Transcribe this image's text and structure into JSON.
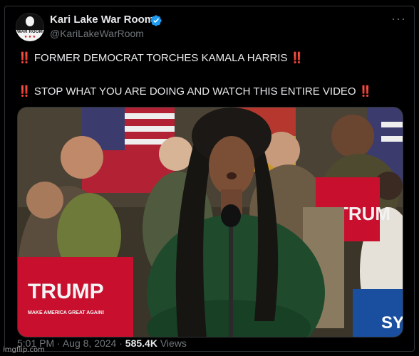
{
  "tweet": {
    "author_name": "Kari Lake War Room",
    "handle": "@KariLakeWarRoom",
    "avatar": {
      "text": "WAR ROOM",
      "stars": "★ ★ ★"
    },
    "more_icon": "more-dots-icon",
    "verified_icon": "verified-badge-icon",
    "text_line_1": "FORMER DEMOCRAT TORCHES KAMALA HARRIS",
    "text_line_2": "STOP WHAT YOU ARE DOING AND WATCH THIS ENTIRE VIDEO",
    "emoji": "‼️",
    "media": {
      "sign_left": {
        "title": "TRUMP",
        "subtitle": "MAKE AMERICA GREAT AGAIN!"
      },
      "sign_right_partial": "TRUM",
      "sign_far_right_partial": "SY"
    },
    "time": "5:01 PM",
    "separator": "·",
    "date": "Aug 8, 2024",
    "views_count": "585.4K",
    "views_label": "Views"
  },
  "watermark": "imgflip.com",
  "colors": {
    "background": "#000000",
    "text_primary": "#e7e9ea",
    "text_secondary": "#71767b",
    "verified_blue": "#1d9bf0",
    "emoji_red": "#f4212e",
    "sign_red": "#c8102e"
  }
}
